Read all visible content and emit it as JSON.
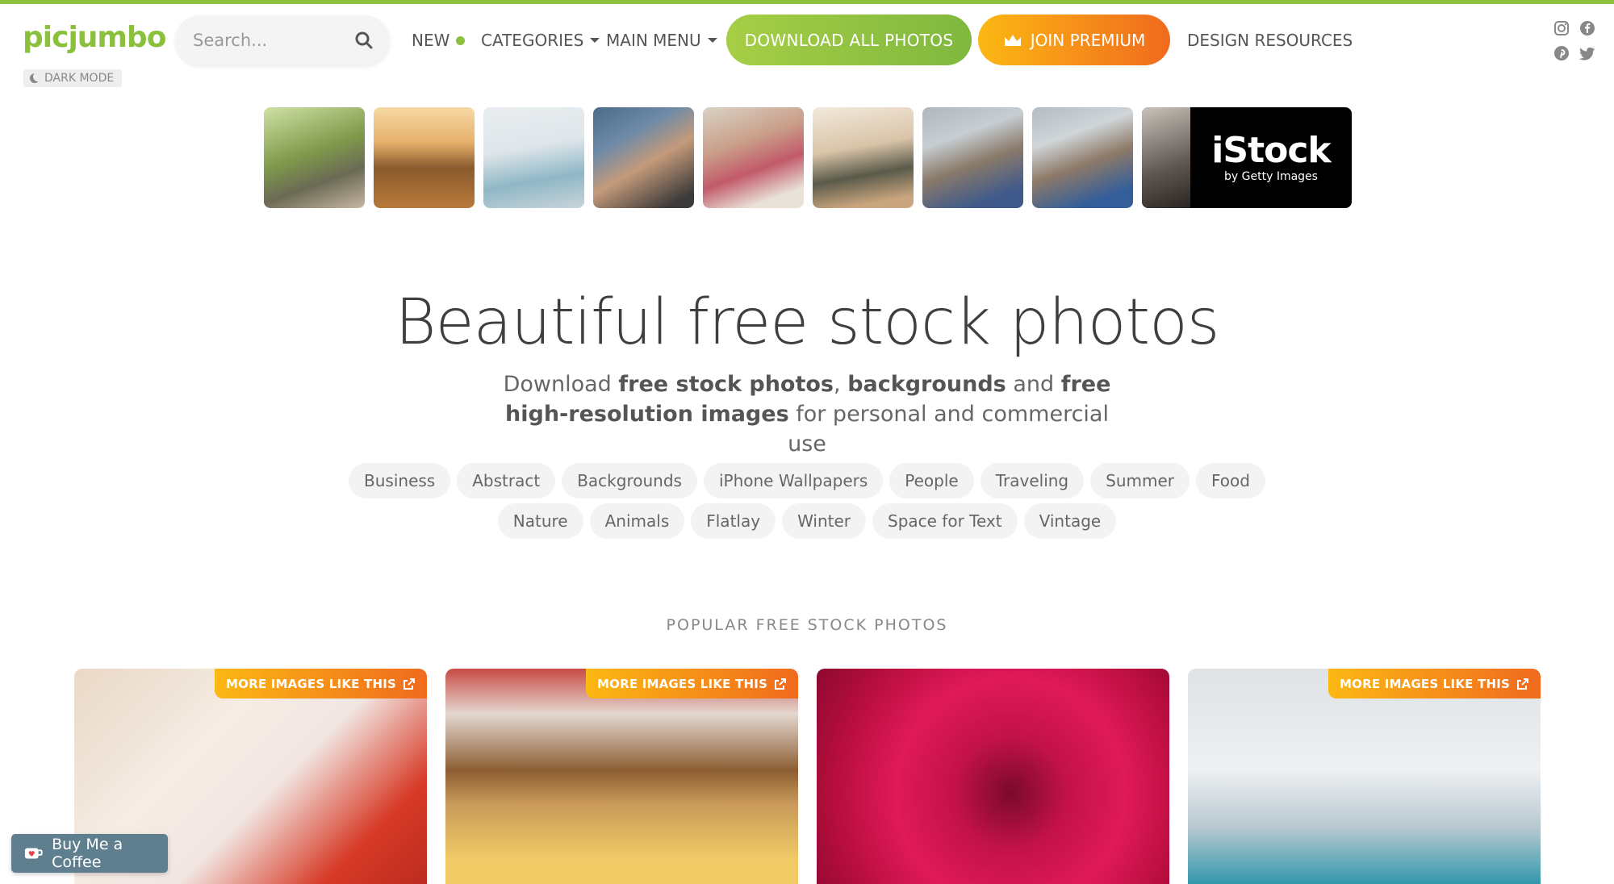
{
  "brand": {
    "logo": "picjumbo",
    "accent": "#8bc03d",
    "premium_gradient": [
      "#fcb813",
      "#f06a1e"
    ]
  },
  "header": {
    "dark_mode_label": "DARK MODE",
    "search_placeholder": "Search...",
    "nav_new": "NEW",
    "nav_categories": "CATEGORIES",
    "nav_main_menu": "MAIN MENU",
    "download_all": "DOWNLOAD ALL PHOTOS",
    "join_premium": "JOIN PREMIUM",
    "design_resources": "DESIGN RESOURCES",
    "social_icons": [
      "instagram-icon",
      "facebook-icon",
      "pinterest-icon",
      "twitter-icon"
    ]
  },
  "ad_strip": {
    "thumbnails": [
      "family-photo-1",
      "family-photo-2",
      "family-photo-3",
      "family-photo-4",
      "family-photo-5",
      "family-photo-6",
      "family-photo-7",
      "family-photo-8"
    ],
    "istock_word": "iStock",
    "istock_sub": "by Getty Images"
  },
  "hero": {
    "title": "Beautiful free stock photos",
    "sub_1": "Download ",
    "sub_2": "free stock photos",
    "sub_3": ", ",
    "sub_4": "backgrounds",
    "sub_5": " and ",
    "sub_6": "free high-resolution images",
    "sub_7": " for personal and commercial use"
  },
  "tags_row1": [
    "Business",
    "Abstract",
    "Backgrounds",
    "iPhone Wallpapers",
    "People",
    "Traveling",
    "Summer",
    "Food"
  ],
  "tags_row2": [
    "Nature",
    "Animals",
    "Flatlay",
    "Winter",
    "Space for Text",
    "Vintage"
  ],
  "popular_heading": "POPULAR FREE STOCK PHOTOS",
  "cards": [
    {
      "name": "girl-with-teddy-bear-photo",
      "more_label": "MORE IMAGES LIKE THIS"
    },
    {
      "name": "pizza-flatlay-photo",
      "more_label": "MORE IMAGES LIKE THIS"
    },
    {
      "name": "red-rose-photo",
      "more_label": ""
    },
    {
      "name": "golden-gate-bridge-photo",
      "more_label": "MORE IMAGES LIKE THIS"
    }
  ],
  "coffee_button": "Buy Me a Coffee"
}
